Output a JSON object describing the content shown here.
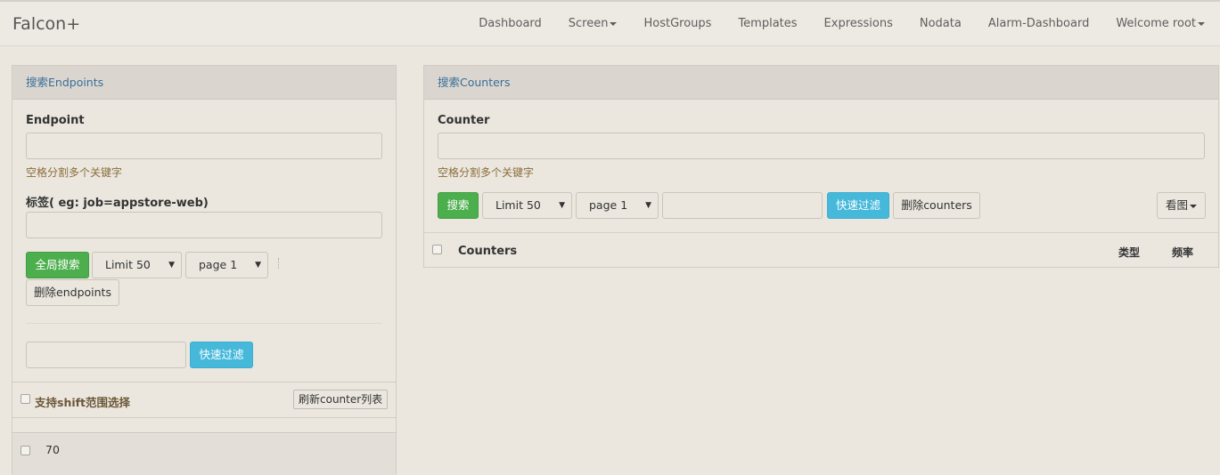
{
  "brand": "Falcon+",
  "nav": {
    "dashboard": "Dashboard",
    "screen": "Screen",
    "hostgroups": "HostGroups",
    "templates": "Templates",
    "expressions": "Expressions",
    "nodata": "Nodata",
    "alarm_dashboard": "Alarm-Dashboard",
    "welcome": "Welcome root"
  },
  "endpoints_panel": {
    "heading": "搜索Endpoints",
    "endpoint_label": "Endpoint",
    "endpoint_value": "",
    "endpoint_help": "空格分割多个关键字",
    "tags_label": "标签( eg: job=appstore-web)",
    "tags_value": "",
    "search_all_button": "全局搜索",
    "limit_select": "Limit 50",
    "page_select": "page 1",
    "delete_button": "删除endpoints",
    "quick_filter_value": "",
    "quick_filter_button": "快速过滤",
    "shift_select_label": "支持shift范围选择",
    "refresh_button": "刷新counter列表",
    "rows": [
      {
        "name": "70"
      }
    ]
  },
  "counters_panel": {
    "heading": "搜索Counters",
    "counter_label": "Counter",
    "counter_value": "",
    "counter_help": "空格分割多个关键字",
    "search_button": "搜索",
    "limit_select": "Limit 50",
    "page_select": "page 1",
    "quick_filter_value": "",
    "quick_filter_button": "快速过滤",
    "delete_button": "删除counters",
    "view_graph_button": "看图",
    "table_headers": {
      "counters": "Counters",
      "type": "类型",
      "frequency": "频率"
    }
  }
}
